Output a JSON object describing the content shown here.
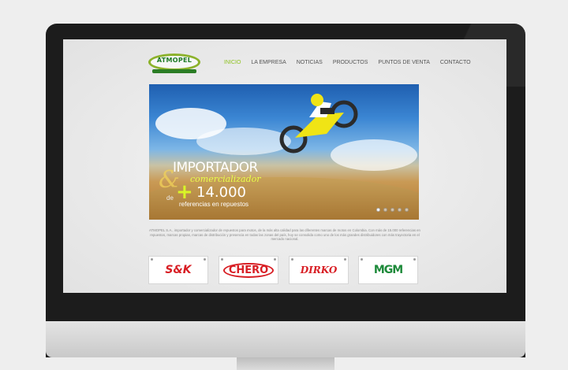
{
  "site": {
    "logo_text": "ATMOPEL",
    "nav": [
      "INICIO",
      "LA EMPRESA",
      "NOTICIAS",
      "PRODUCTOS",
      "PUNTOS DE VENTA",
      "CONTACTO"
    ],
    "active_nav": "INICIO",
    "accent_color": "#8dc21f"
  },
  "hero": {
    "line1": "IMPORTADOR",
    "ampersand": "&",
    "line2": "comercializador",
    "plus": "+",
    "de": "de",
    "number": "14.000",
    "line3": "referencias en repuestos",
    "slides": 5,
    "active_slide": 1
  },
  "description": "ATMOPEL S.A., importador y comercializador de repuestos para motos, de la más alta calidad para las diferentes marcas de motos en Colombia. Con más de 15.000 referencias en repuestos, marcas propias, marcas de distribución y presencia en todas las zonas del país, hoy se consolida como uno de los más grandes distribuidores con más trayectoria en el mercado nacional.",
  "brands": [
    "S&K",
    "CHERO",
    "DIRKO",
    "MGM"
  ]
}
